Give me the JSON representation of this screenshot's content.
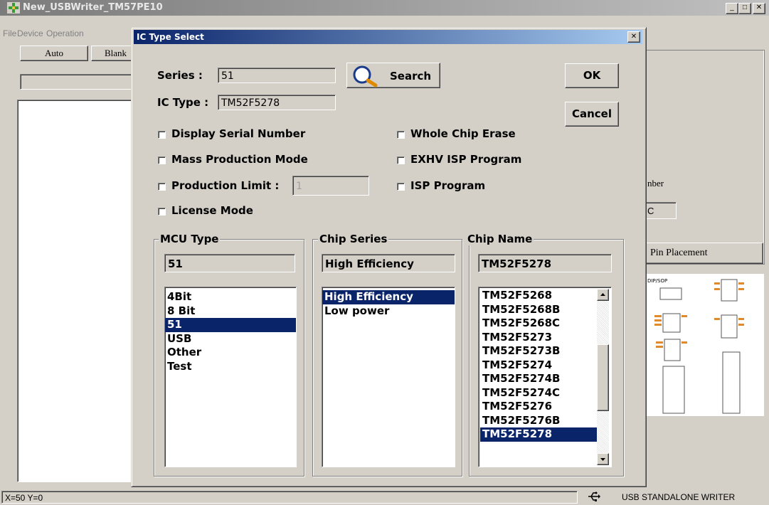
{
  "main_window": {
    "title": "New_USBWriter_TM57PE10",
    "menu": [
      "File",
      "Device",
      "Operation"
    ],
    "toolbar": {
      "auto_label": "Auto",
      "blank_label": "Blank"
    },
    "right_panel": {
      "label_fragment": "nber",
      "value_fragment": "C",
      "pin_placement_label": "Pin Placement"
    }
  },
  "dialog": {
    "title": "IC Type Select",
    "close_glyph": "✕",
    "series_label": "Series :",
    "series_value": "51",
    "search_label": "Search",
    "ic_type_label": "IC Type :",
    "ic_type_value": "TM52F5278",
    "ok_label": "OK",
    "cancel_label": "Cancel",
    "options": {
      "display_serial": "Display Serial Number",
      "mass_production": "Mass Production Mode",
      "production_limit": "Production Limit :",
      "production_limit_value": "1",
      "license_mode": "License Mode",
      "whole_chip_erase": "Whole Chip Erase",
      "exhv_isp": "EXHV ISP Program",
      "isp_program": "ISP Program"
    },
    "mcu_type": {
      "title": "MCU Type",
      "selected": "51",
      "items": [
        "4Bit",
        "8 Bit",
        "51",
        "USB",
        "Other",
        "Test"
      ],
      "selected_index": 2
    },
    "chip_series": {
      "title": "Chip Series",
      "selected": "High Efficiency",
      "items": [
        "High Efficiency",
        "Low power"
      ],
      "selected_index": 0
    },
    "chip_name": {
      "title": "Chip Name",
      "selected": "TM52F5278",
      "items": [
        "TM52F5268",
        "TM52F5268B",
        "TM52F5268C",
        "TM52F5273",
        "TM52F5273B",
        "TM52F5274",
        "TM52F5274B",
        "TM52F5274C",
        "TM52F5276",
        "TM52F5276B",
        "TM52F5278"
      ],
      "selected_index": 10
    }
  },
  "status_bar": {
    "coords": "X=50 Y=0",
    "usb_icon": "usb-icon",
    "writer_label": "USB STANDALONE WRITER"
  },
  "colors": {
    "selection": "#0a246a",
    "dialog_title": "#0a246a",
    "face": "#d4d0c8"
  }
}
